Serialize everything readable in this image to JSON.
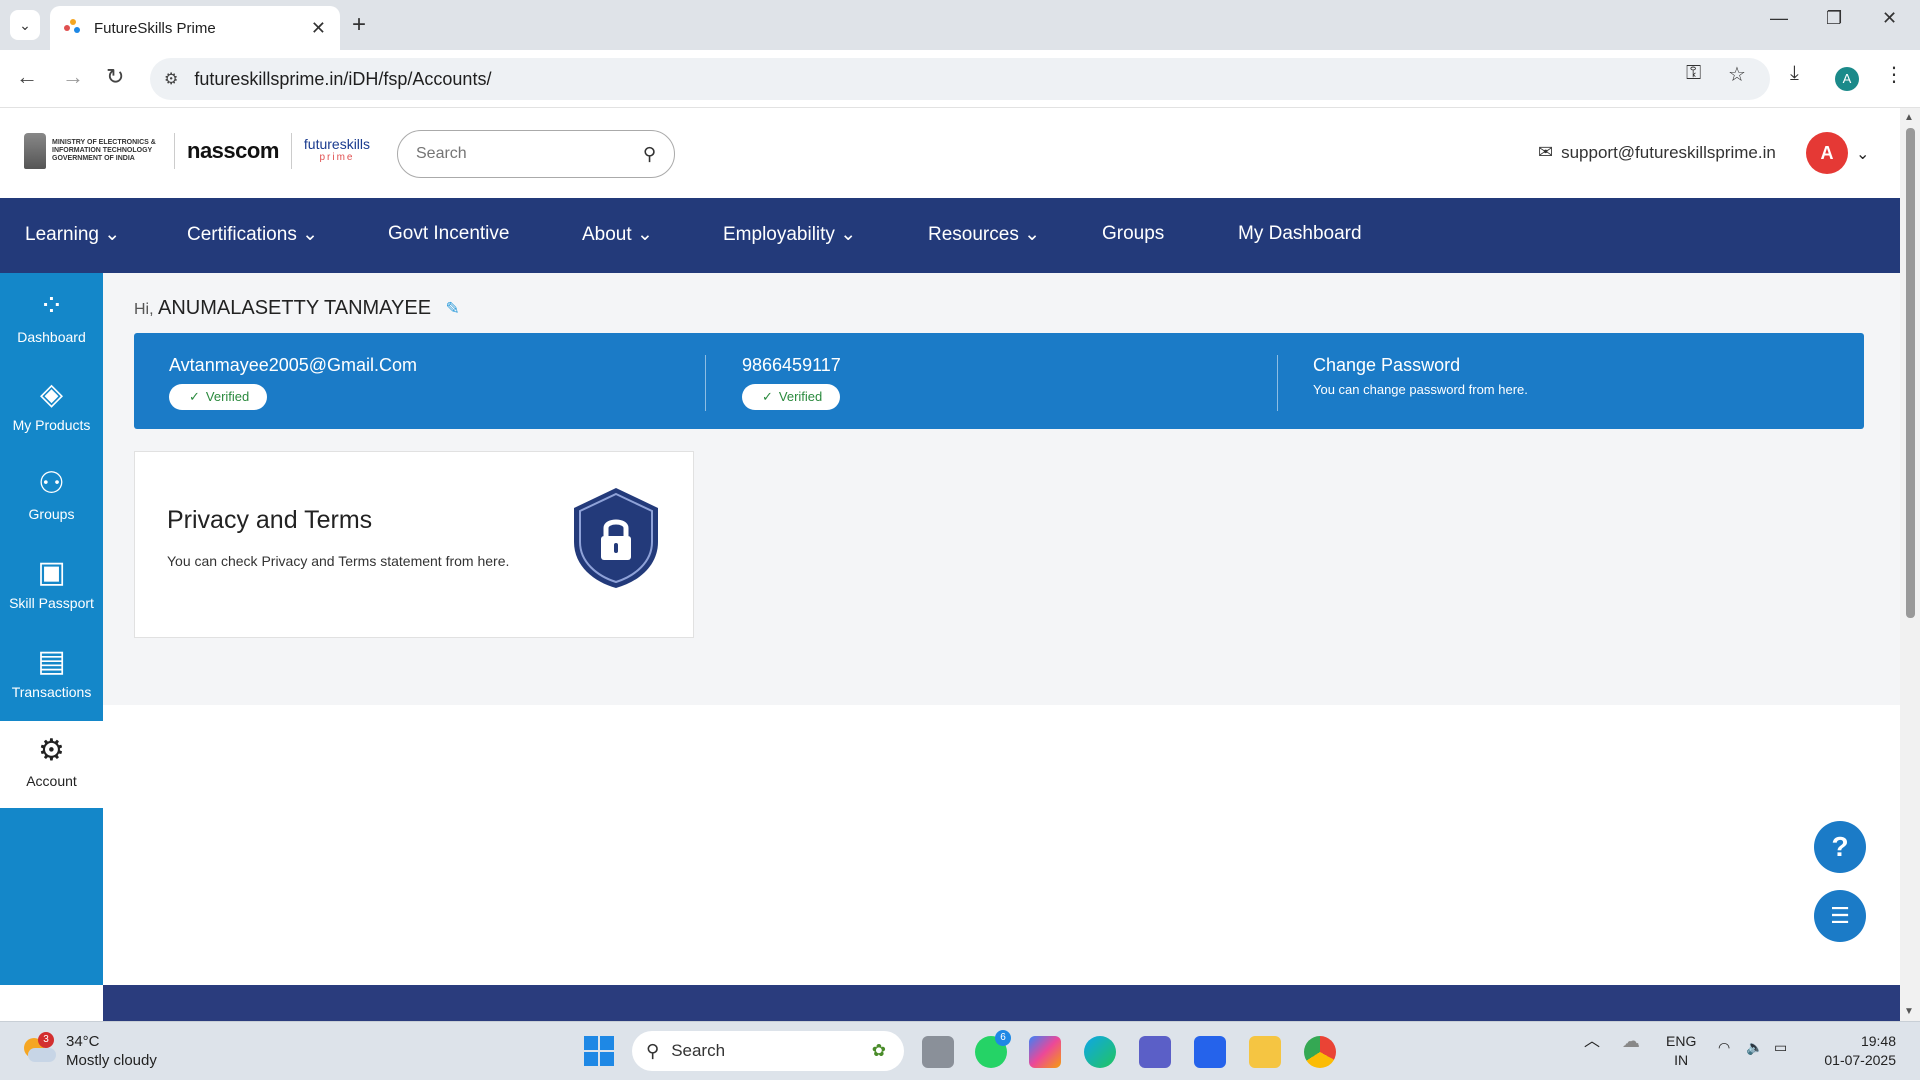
{
  "browser": {
    "tab_title": "FutureSkills Prime",
    "url": "futureskillsprime.in/iDH/fsp/Accounts/",
    "profile_initial": "A"
  },
  "header": {
    "gov_text": "MINISTRY OF ELECTRONICS & INFORMATION TECHNOLOGY GOVERNMENT OF INDIA",
    "nasscom": "nasscom",
    "fsp_logo": "futureskills",
    "fsp_sub": "prime",
    "search_placeholder": "Search",
    "support_email": "support@futureskillsprime.in",
    "avatar_initial": "A"
  },
  "nav": {
    "items": [
      {
        "label": "Learning",
        "dropdown": true
      },
      {
        "label": "Certifications",
        "dropdown": true
      },
      {
        "label": "Govt Incentive",
        "dropdown": false
      },
      {
        "label": "About",
        "dropdown": true
      },
      {
        "label": "Employability",
        "dropdown": true
      },
      {
        "label": "Resources",
        "dropdown": true
      },
      {
        "label": "Groups",
        "dropdown": false
      },
      {
        "label": "My Dashboard",
        "dropdown": false
      }
    ]
  },
  "sidebar": {
    "items": [
      {
        "label": "Dashboard",
        "icon": "dashboard-icon"
      },
      {
        "label": "My Products",
        "icon": "layers-icon"
      },
      {
        "label": "Groups",
        "icon": "groups-icon"
      },
      {
        "label": "Skill Passport",
        "icon": "passport-icon"
      },
      {
        "label": "Transactions",
        "icon": "card-icon"
      },
      {
        "label": "Account",
        "icon": "account-settings-icon",
        "active": true
      }
    ]
  },
  "account": {
    "greeting_prefix": "Hi,",
    "user_name": "ANUMALASETTY TANMAYEE",
    "email": "Avtanmayee2005@Gmail.Com",
    "email_status": "Verified",
    "phone": "9866459117",
    "phone_status": "Verified",
    "change_password_title": "Change Password",
    "change_password_sub": "You can change password from here.",
    "privacy_title": "Privacy and Terms",
    "privacy_sub": "You can check Privacy and Terms statement from here."
  },
  "fab": {
    "help": "?"
  },
  "taskbar": {
    "weather_temp": "34°C",
    "weather_desc": "Mostly cloudy",
    "weather_badge": "3",
    "search_label": "Search",
    "whatsapp_badge": "6",
    "lang_top": "ENG",
    "lang_bottom": "IN",
    "time": "19:48",
    "date": "01-07-2025"
  },
  "colors": {
    "nav_bg": "#233a7a",
    "sidebar_bg": "#1487c9",
    "card_bg": "#1b7bc7",
    "avatar": "#e53935",
    "verified_text": "#2b8a3e"
  }
}
